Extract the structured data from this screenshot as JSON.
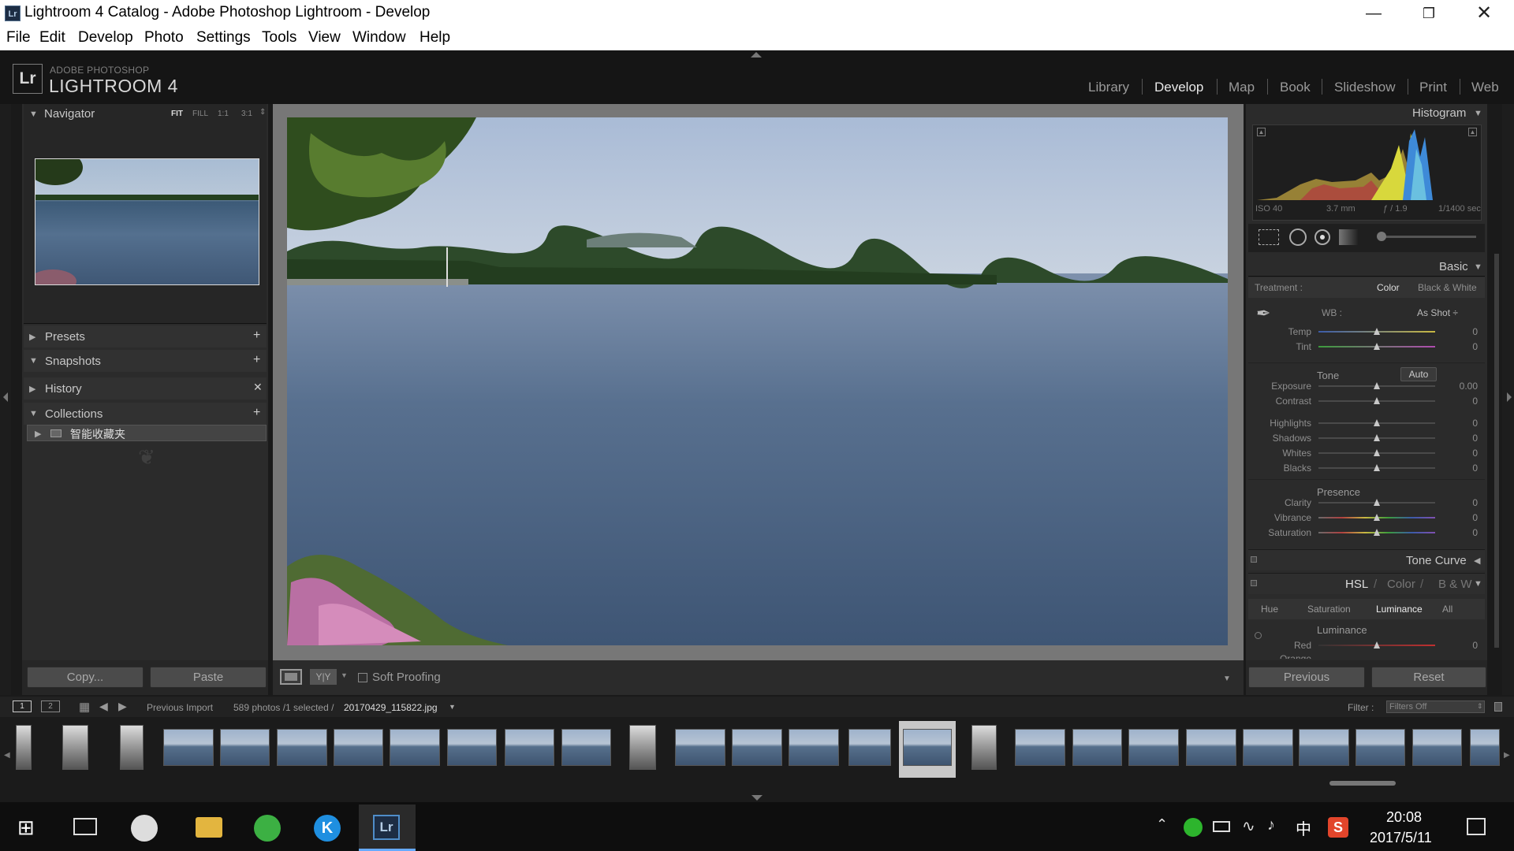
{
  "window": {
    "title": "Lightroom 4 Catalog - Adobe Photoshop Lightroom - Develop",
    "icon": "Lr",
    "minimize_icon": "minimize-icon",
    "maximize_icon": "restore-icon",
    "close_icon": "close-icon"
  },
  "menu": [
    "File",
    "Edit",
    "Develop",
    "Photo",
    "Settings",
    "Tools",
    "View",
    "Window",
    "Help"
  ],
  "lr": {
    "logo": "Lr",
    "brand_top": "ADOBE PHOTOSHOP",
    "brand_main": "LIGHTROOM 4"
  },
  "modules": [
    {
      "label": "Library",
      "active": false
    },
    {
      "label": "Develop",
      "active": true
    },
    {
      "label": "Map",
      "active": false
    },
    {
      "label": "Book",
      "active": false
    },
    {
      "label": "Slideshow",
      "active": false
    },
    {
      "label": "Print",
      "active": false
    },
    {
      "label": "Web",
      "active": false
    }
  ],
  "left": {
    "navigator": {
      "title": "Navigator",
      "zoom": [
        "FIT",
        "FILL",
        "1:1",
        "3:1"
      ]
    },
    "presets": "Presets",
    "snapshots": "Snapshots",
    "history": "History",
    "collections": "Collections",
    "collection_item": "智能收藏夹",
    "copy": "Copy...",
    "paste": "Paste"
  },
  "center": {
    "soft_proofing": "Soft Proofing",
    "view_before_after": "Y|Y"
  },
  "histogram": {
    "title": "Histogram",
    "iso": "ISO 40",
    "focal": "3.7 mm",
    "aperture": "ƒ / 1.9",
    "shutter": "1/1400 sec"
  },
  "basic": {
    "title": "Basic",
    "treatment_label": "Treatment :",
    "color": "Color",
    "bw": "Black & White",
    "wb_label": "WB :",
    "wb_value": "As Shot ÷",
    "wb_sliders": [
      {
        "label": "Temp",
        "value": "0",
        "pos": 0.5
      },
      {
        "label": "Tint",
        "value": "0",
        "pos": 0.5
      }
    ],
    "tone_label": "Tone",
    "auto": "Auto",
    "tone_sliders": [
      {
        "label": "Exposure",
        "value": "0.00",
        "pos": 0.5
      },
      {
        "label": "Contrast",
        "value": "0",
        "pos": 0.5
      }
    ],
    "tone2_sliders": [
      {
        "label": "Highlights",
        "value": "0",
        "pos": 0.5
      },
      {
        "label": "Shadows",
        "value": "0",
        "pos": 0.5
      },
      {
        "label": "Whites",
        "value": "0",
        "pos": 0.5
      },
      {
        "label": "Blacks",
        "value": "0",
        "pos": 0.5
      }
    ],
    "presence_label": "Presence",
    "presence_sliders": [
      {
        "label": "Clarity",
        "value": "0",
        "pos": 0.5
      },
      {
        "label": "Vibrance",
        "value": "0",
        "pos": 0.5
      },
      {
        "label": "Saturation",
        "value": "0",
        "pos": 0.5
      }
    ]
  },
  "tone_curve": "Tone Curve",
  "hsl": {
    "title": "HSL",
    "color": "Color",
    "bw": "B & W",
    "slash": "/",
    "tabs": [
      "Hue",
      "Saturation",
      "Luminance",
      "All"
    ],
    "active_tab": "Luminance",
    "group": "Luminance",
    "sliders": [
      {
        "label": "Red",
        "value": "0",
        "pos": 0.5
      },
      {
        "label": "Orange",
        "value": "",
        "pos": 0.5
      }
    ]
  },
  "right_buttons": {
    "previous": "Previous",
    "reset": "Reset"
  },
  "filmstrip": {
    "view1": "1",
    "view2": "2",
    "source": "Previous Import",
    "count": "589 photos /1 selected /",
    "filename": "20170429_115822.jpg",
    "filter_label": "Filter :",
    "filter_value": "Filters Off"
  },
  "taskbar": {
    "time": "20:08",
    "date": "2017/5/11",
    "ime": "中"
  }
}
